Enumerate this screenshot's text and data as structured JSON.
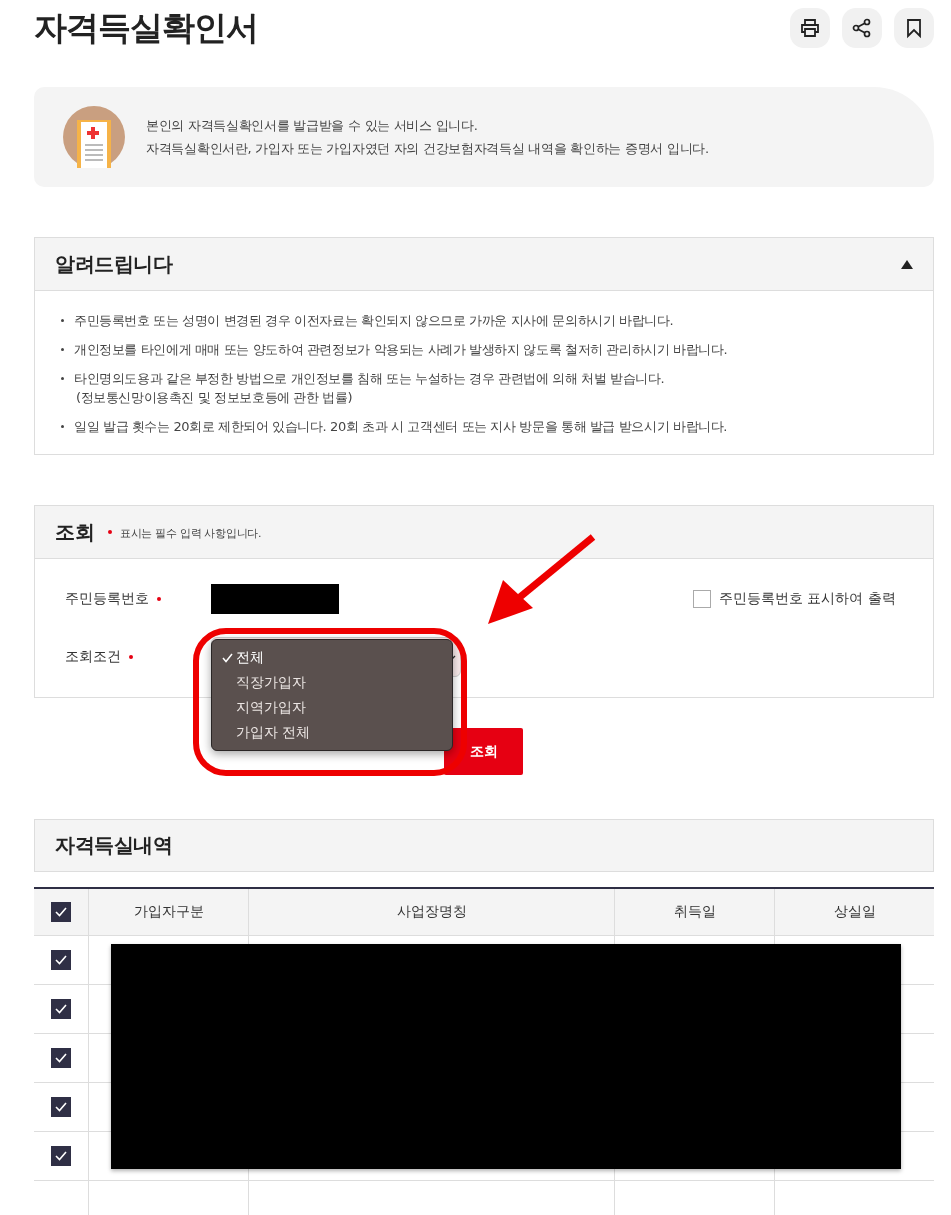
{
  "page": {
    "title": "자격득실확인서"
  },
  "toolbar": [
    {
      "kind": "print"
    },
    {
      "kind": "share"
    },
    {
      "kind": "bookmark"
    }
  ],
  "intro": {
    "lines": [
      "본인의 자격득실확인서를 발급받을 수 있는 서비스 입니다.",
      "자격득실확인서란, 가입자 또는 가입자였던 자의 건강보험자격득실 내역을 확인하는 증명서 입니다."
    ]
  },
  "notice": {
    "title": "알려드립니다",
    "expanded": true,
    "items": [
      {
        "text": "주민등록번호 또는 성명이 변경된 경우 이전자료는 확인되지 않으므로 가까운 지사에 문의하시기 바랍니다."
      },
      {
        "text": "개인정보를 타인에게 매매 또는 양도하여 관련정보가 악용되는 사례가 발생하지 않도록 철저히 관리하시기 바랍니다."
      },
      {
        "text": "타인명의도용과 같은 부정한 방법으로 개인정보를 침해 또는 누설하는 경우 관련법에 의해 처벌 받습니다.",
        "note": "(정보통신망이용촉진 및 정보보호등에 관한 법률)"
      },
      {
        "text": "일일 발급 횟수는 20회로 제한되어 있습니다. 20회 초과 시 고객센터 또는 지사 방문을 통해 발급 받으시기 바랍니다."
      }
    ]
  },
  "search": {
    "title": "조회",
    "required_hint": "표시는 필수 입력 사항입니다.",
    "fields": [
      {
        "label": "주민등록번호",
        "required": true,
        "kind": "redacted"
      },
      {
        "label": "조회조건",
        "required": true,
        "kind": "select",
        "options": [
          {
            "label": "전체",
            "selected": true
          },
          {
            "label": "직장가입자",
            "selected": false
          },
          {
            "label": "지역가입자",
            "selected": false
          },
          {
            "label": "가입자 전체",
            "selected": false
          }
        ]
      }
    ],
    "print_option": {
      "label": "주민등록번호 표시하여 출력",
      "checked": false
    },
    "submit": "조회"
  },
  "history": {
    "title": "자격득실내역",
    "select_all": true,
    "columns": [
      "가입자구분",
      "사업장명칭",
      "취득일",
      "상실일"
    ],
    "rows": [
      {
        "checked": true
      },
      {
        "checked": true
      },
      {
        "checked": true
      },
      {
        "checked": true
      },
      {
        "checked": true
      }
    ]
  }
}
